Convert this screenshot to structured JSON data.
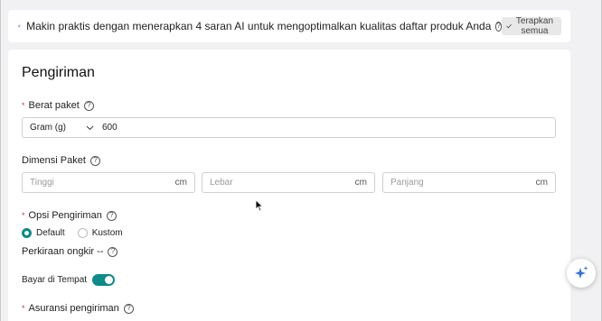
{
  "ai_banner": {
    "message": "Makin praktis dengan menerapkan 4 saran AI untuk mengoptimalkan kualitas daftar produk Anda",
    "apply_label": "Terapkan semua"
  },
  "shipping": {
    "title": "Pengiriman",
    "weight": {
      "label": "Berat paket",
      "unit": "Gram (g)",
      "value": "600"
    },
    "dimensions": {
      "label": "Dimensi Paket",
      "fields": [
        {
          "placeholder": "Tinggi",
          "unit": "cm"
        },
        {
          "placeholder": "Lebar",
          "unit": "cm"
        },
        {
          "placeholder": "Panjang",
          "unit": "cm"
        }
      ]
    },
    "options": {
      "label": "Opsi Pengiriman",
      "choices": [
        "Default",
        "Kustom"
      ],
      "selected": "Default"
    },
    "estimate_label": "Perkiraan ongkir --",
    "cod_label": "Bayar di Tempat",
    "cod_enabled": true,
    "insurance_label": "Asuransi pengiriman"
  },
  "colors": {
    "accent": "#0d8b86",
    "required": "#d9363e"
  }
}
